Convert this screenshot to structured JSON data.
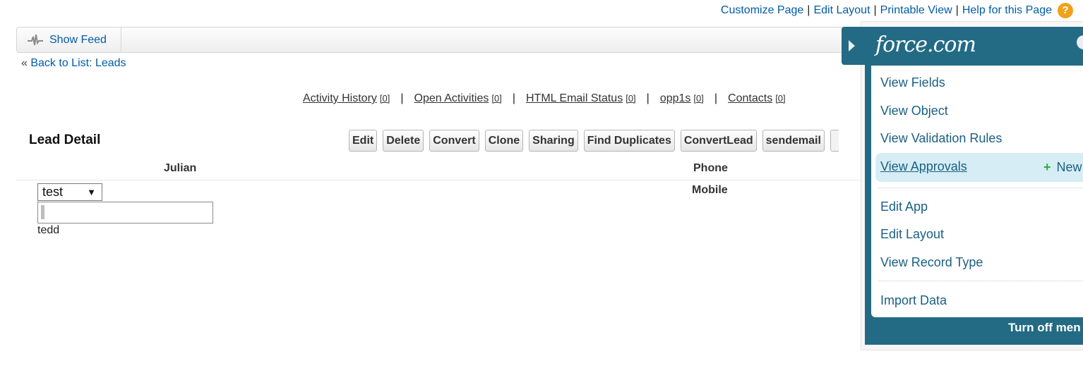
{
  "top_links": {
    "customize_page": "Customize Page",
    "edit_layout": "Edit Layout",
    "printable_view": "Printable View",
    "help": "Help for this Page",
    "separator": "|",
    "help_icon_glyph": "?"
  },
  "feed": {
    "show_feed_label": "Show Feed"
  },
  "back_link": {
    "prefix": "«",
    "label": "Back to List: Leads"
  },
  "related_links": [
    {
      "label": "Activity History",
      "count": "[0]"
    },
    {
      "label": "Open Activities",
      "count": "[0]"
    },
    {
      "label": "HTML Email Status",
      "count": "[0]"
    },
    {
      "label": "opp1s",
      "count": "[0]"
    },
    {
      "label": "Contacts",
      "count": "[0]"
    }
  ],
  "detail": {
    "title": "Lead Detail",
    "buttons": [
      "Edit",
      "Delete",
      "Convert",
      "Clone",
      "Sharing",
      "Find Duplicates",
      "ConvertLead",
      "sendemail"
    ],
    "col_name": "Julian",
    "col_phone": "Phone",
    "label_mobile": "Mobile",
    "select_value": "test",
    "text_value": "tedd"
  },
  "force_menu": {
    "logo": "force.com",
    "items": {
      "view_fields": "View Fields",
      "view_object": "View Object",
      "view_validation_rules": "View Validation Rules",
      "view_approvals": "View Approvals",
      "new": "New",
      "edit_app": "Edit App",
      "edit_layout": "Edit Layout",
      "view_record_type": "View Record Type",
      "import_data": "Import Data"
    },
    "footer": "Turn off men"
  },
  "colors": {
    "link": "#015ba7",
    "menu_teal": "#236b84",
    "highlight": "#d6edf5",
    "plus_green": "#2dab3a",
    "help_orange": "#f0a21b"
  },
  "icons": [
    "feed-pulse-icon",
    "help-icon",
    "dropdown-arrow-icon",
    "expand-triangle-icon",
    "settings-icon",
    "plus-icon"
  ]
}
